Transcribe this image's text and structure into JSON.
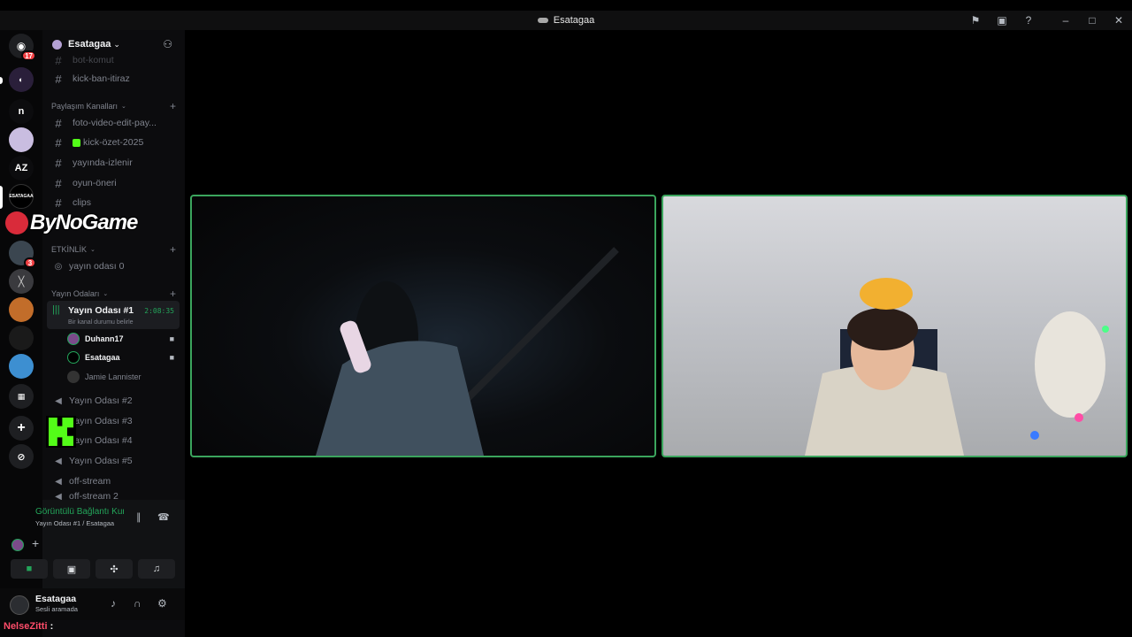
{
  "window": {
    "title": "Esatagaa"
  },
  "rail": {
    "dm_badge": "17",
    "items": [
      {
        "label": "n"
      },
      {
        "label": "AZ"
      },
      {
        "label": "ESATAGAA"
      },
      {
        "label": "",
        "badge": "3"
      }
    ]
  },
  "guild": {
    "name": "Esatagaa"
  },
  "channels": {
    "top": [
      {
        "label": "bot-komut"
      },
      {
        "label": "kick-ban-itiraz"
      }
    ],
    "paylasim_category": "Paylaşım Kanalları",
    "paylasim": [
      {
        "label": "foto-video-edit-pay..."
      },
      {
        "label": "kick-özet-2025"
      },
      {
        "label": "yayında-izlenir"
      },
      {
        "label": "oyun-öneri"
      },
      {
        "label": "clips"
      }
    ],
    "etkinlik_category": "ETKİNLİK",
    "etkinlik": [
      {
        "label": "yayın odası 0"
      }
    ],
    "yayin_category": "Yayın Odaları",
    "active": {
      "name": "Yayın Odası #1",
      "timer": "2:08:35",
      "status": "Bir kanal durumu belirle"
    },
    "users": [
      {
        "name": "Duhann17"
      },
      {
        "name": "Esatagaa"
      },
      {
        "name": "Jamie Lannister"
      }
    ],
    "voice": [
      {
        "label": "Yayın Odası #2"
      },
      {
        "label": "Yayın Odası #3"
      },
      {
        "label": "Yayın Odası #4"
      },
      {
        "label": "Yayın Odası #5"
      },
      {
        "label": "off-stream"
      },
      {
        "label": "off-stream 2"
      }
    ]
  },
  "overlay": {
    "brand": "ByNoGame",
    "chat_user": "NelseZitti",
    "chat_sep": ":"
  },
  "voice_panel": {
    "status": "Görüntülü Bağlantı Kuruldu",
    "location": "Yayın Odası #1 / Esatagaa"
  },
  "user_panel": {
    "name": "Esatagaa",
    "status": "Sesli aramada"
  },
  "colors": {
    "accent_green": "#23a55a",
    "kick_green": "#53fc18",
    "badge_red": "#f23f43"
  }
}
